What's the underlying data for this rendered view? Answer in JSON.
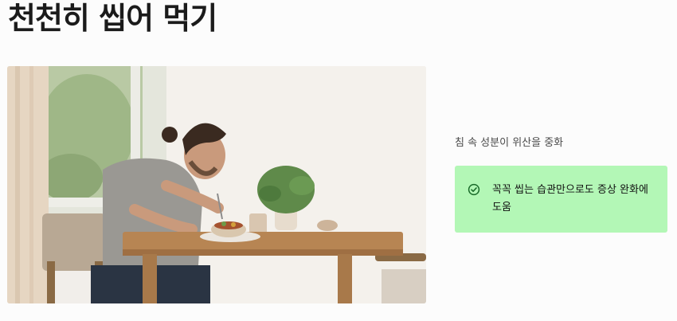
{
  "heading": {
    "title": "천천히 씹어 먹기"
  },
  "photo": {
    "alt": "식탁에서 천천히 식사하는 남성"
  },
  "caption": {
    "text": "침 속 성분이 위산을 중화"
  },
  "callout": {
    "icon": "check-circle-icon",
    "text": "꼭꼭 씹는 습관만으로도 증상 완화에 도움",
    "background": "#b3f7b6",
    "icon_color": "#1a6b2a"
  }
}
